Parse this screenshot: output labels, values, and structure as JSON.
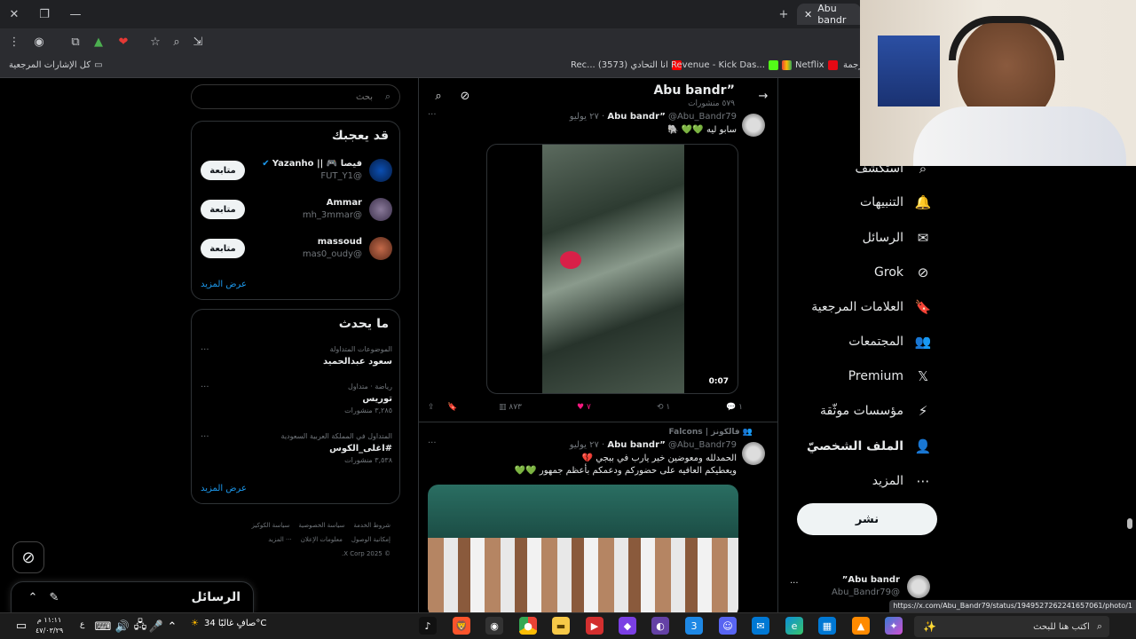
{
  "browser": {
    "tab_title": "Abu bandr",
    "bookmarks_all": "كل الإشارات المرجعية",
    "bookmarks": [
      {
        "label": "Rec... انا التحادي (3573)",
        "color": "#ff0000"
      },
      {
        "label": "Revenue - Kick Das...",
        "color": "#53fc18"
      },
      {
        "label": "Netflix",
        "color": "#e50914"
      },
      {
        "label": "رجمة",
        "color": "#888"
      }
    ],
    "status_url": "https://x.com/Abu_Bandr79/status/1949527262241657061/photo/1"
  },
  "search": {
    "placeholder": "بحث"
  },
  "suggest": {
    "title": "قد يعجبك",
    "follow_label": "متابعة",
    "show_more": "عرض المزيد",
    "users": [
      {
        "name": "فيصا 🎮 || Yazanho",
        "handle": "@FUT_Y1",
        "verified": true
      },
      {
        "name": "Ammar",
        "handle": "@mh_3mmar"
      },
      {
        "name": "massoud",
        "handle": "@mas0_oudy"
      }
    ]
  },
  "trends": {
    "title": "ما يحدث",
    "show_more": "عرض المزيد",
    "items": [
      {
        "context": "الموضوعات المتداولة",
        "topic": "سعود عبدالحميد",
        "count": ""
      },
      {
        "context": "رياضة · متداول",
        "topic": "توريس",
        "count": "٣,٢٨٥ منشورات"
      },
      {
        "context": "المتداول في المملكة العربية السعودية",
        "topic": "#اغلى_الكوس",
        "count": "٣,٥٣٨ منشورات"
      }
    ]
  },
  "footer": {
    "row1": [
      "شروط الخدمة",
      "سياسة الخصوصية",
      "سياسة الكوكيز"
    ],
    "row2": [
      "إمكانية الوصول",
      "معلومات الإعلان",
      "··· المزيد"
    ],
    "copy": "© 2025 X Corp."
  },
  "messages": {
    "title": "الرسائل"
  },
  "profile_header": {
    "name": "Abu bandr”",
    "posts": "٥٧٩ منشورات"
  },
  "tweet1": {
    "name": "Abu bandr”",
    "handle": "@Abu_Bandr79",
    "date": "٢٧ يوليو",
    "text": "سابو ليه 💚💚 🐘",
    "duration": "0:07",
    "views": "٨٧٣",
    "likes": "٧",
    "retweets": "١",
    "replies": "١"
  },
  "tweet2": {
    "social": "فالكونز | Falcons",
    "name": "Abu bandr”",
    "handle": "@Abu_Bandr79",
    "date": "٢٧ يوليو",
    "line1": "الحمدلله ومعوضين خير يارب في ببجي 💔",
    "line2": "ويعطيكم العافيه على حضوركم ودعمكم بأعظم جمهور 💚💚"
  },
  "nav": {
    "items": [
      {
        "label": "استكشف",
        "icon": "🔍",
        "name": "explore"
      },
      {
        "label": "التنبيهات",
        "icon": "🔔",
        "name": "notifications"
      },
      {
        "label": "الرسائل",
        "icon": "✉",
        "name": "messages"
      },
      {
        "label": "Grok",
        "icon": "⊘",
        "name": "grok"
      },
      {
        "label": "العلامات المرجعية",
        "icon": "🔖",
        "name": "bookmarks"
      },
      {
        "label": "المجتمعات",
        "icon": "👥",
        "name": "communities"
      },
      {
        "label": "Premium",
        "icon": "𝕏",
        "name": "premium"
      },
      {
        "label": "مؤسسات موثّقة",
        "icon": "⚡",
        "name": "verified-orgs"
      },
      {
        "label": "الملف الشخصيّ",
        "icon": "👤",
        "name": "profile"
      },
      {
        "label": "المزيد",
        "icon": "⋯",
        "name": "more"
      }
    ],
    "post_button": "نشر"
  },
  "account": {
    "name": "Abu bandr”",
    "handle": "@Abu_Bandr79"
  },
  "taskbar": {
    "search_placeholder": "اكتب هنا للبحث",
    "weather": "صافٍ غالبًا 34°C",
    "time": "١١:١١ م",
    "date": "٤٧/٠٣/٢٩",
    "lang": "ع"
  },
  "colors": {
    "accent": "#1d9bf0",
    "like": "#f91880",
    "bg": "#000000"
  }
}
